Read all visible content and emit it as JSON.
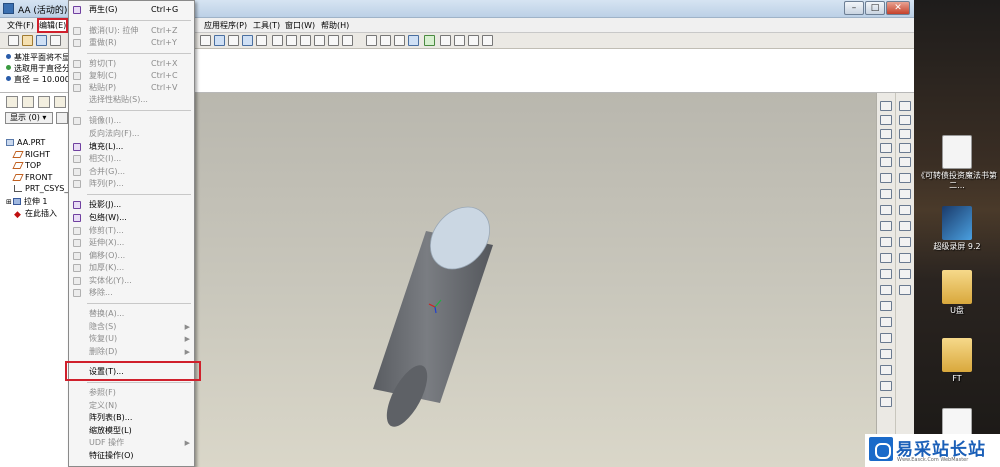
{
  "window": {
    "title": "AA (活动的) - P",
    "min_label": "–",
    "max_label": "□",
    "close_label": "✕"
  },
  "menubar": {
    "items": [
      {
        "label": "文件(F)"
      },
      {
        "label": "编辑(E)"
      },
      {
        "label": "应用程序(P)"
      },
      {
        "label": "工具(T)"
      },
      {
        "label": "窗口(W)"
      },
      {
        "label": "帮助(H)"
      }
    ]
  },
  "messages": [
    "基准平面将不显",
    "选取用于直径分",
    "直径 = 10.0000"
  ],
  "navigator": {
    "show_label": "显示 (0) ▾",
    "tree": [
      {
        "label": "AA.PRT",
        "icon": "part-icon"
      },
      {
        "label": "RIGHT",
        "icon": "datum-plane-icon"
      },
      {
        "label": "TOP",
        "icon": "datum-plane-icon"
      },
      {
        "label": "FRONT",
        "icon": "datum-plane-icon"
      },
      {
        "label": "PRT_CSYS_",
        "icon": "csys-icon"
      },
      {
        "label": "拉伸 1",
        "icon": "extrude-icon"
      },
      {
        "label": "在此插入",
        "icon": "insert-here-icon"
      }
    ]
  },
  "edit_menu": {
    "items": [
      {
        "label": "再生(G)",
        "shortcut": "Ctrl+G",
        "disabled": false,
        "icon": "regenerate-icon"
      },
      {
        "label": "撤消(U): 拉伸",
        "shortcut": "Ctrl+Z",
        "disabled": true
      },
      {
        "label": "重做(R)",
        "shortcut": "Ctrl+Y",
        "disabled": true
      },
      {
        "label": "剪切(T)",
        "shortcut": "Ctrl+X",
        "disabled": true
      },
      {
        "label": "复制(C)",
        "shortcut": "Ctrl+C",
        "disabled": true
      },
      {
        "label": "粘贴(P)",
        "shortcut": "Ctrl+V",
        "disabled": true
      },
      {
        "label": "选择性粘贴(S)...",
        "shortcut": "",
        "disabled": true
      },
      {
        "label": "镜像(I)...",
        "shortcut": "",
        "disabled": true
      },
      {
        "label": "反向法向(F)...",
        "shortcut": "",
        "disabled": true
      },
      {
        "label": "填充(L)...",
        "shortcut": "",
        "disabled": false
      },
      {
        "label": "相交(I)...",
        "shortcut": "",
        "disabled": true
      },
      {
        "label": "合并(G)...",
        "shortcut": "",
        "disabled": true
      },
      {
        "label": "阵列(P)...",
        "shortcut": "",
        "disabled": true
      },
      {
        "label": "投影(J)...",
        "shortcut": "",
        "disabled": false
      },
      {
        "label": "包络(W)...",
        "shortcut": "",
        "disabled": false
      },
      {
        "label": "修剪(T)...",
        "shortcut": "",
        "disabled": true
      },
      {
        "label": "延伸(X)...",
        "shortcut": "",
        "disabled": true
      },
      {
        "label": "偏移(O)...",
        "shortcut": "",
        "disabled": true
      },
      {
        "label": "加厚(K)...",
        "shortcut": "",
        "disabled": true
      },
      {
        "label": "实体化(Y)...",
        "shortcut": "",
        "disabled": true
      },
      {
        "label": "移除...",
        "shortcut": "",
        "disabled": true
      },
      {
        "label": "替换(A)...",
        "shortcut": "",
        "disabled": true
      },
      {
        "label": "隐含(S)",
        "shortcut": "",
        "disabled": true,
        "submenu": true
      },
      {
        "label": "恢复(U)",
        "shortcut": "",
        "disabled": true,
        "submenu": true
      },
      {
        "label": "删除(D)",
        "shortcut": "",
        "disabled": true,
        "submenu": true
      },
      {
        "label": "设置(T)...",
        "shortcut": "",
        "disabled": false
      },
      {
        "label": "参照(F)",
        "shortcut": "",
        "disabled": true
      },
      {
        "label": "定义(N)",
        "shortcut": "",
        "disabled": true
      },
      {
        "label": "阵列表(B)...",
        "shortcut": "",
        "disabled": false
      },
      {
        "label": "缩放模型(L)",
        "shortcut": "",
        "disabled": false
      },
      {
        "label": "UDF 操作",
        "shortcut": "",
        "disabled": true,
        "submenu": true
      },
      {
        "label": "特征操作(O)",
        "shortcut": "",
        "disabled": false
      }
    ]
  },
  "desktop": {
    "icons": [
      {
        "label": "《可转债投资魔法书第二..."
      },
      {
        "label": "超级录屏 9.2"
      },
      {
        "label": "U盘"
      },
      {
        "label": "FT"
      }
    ]
  },
  "watermark": {
    "title": "易采站长站",
    "subtitle": "Www.Easck.Com WebMaster"
  },
  "colors": {
    "highlight_box": "#d0202c",
    "cylinder_body": "#6e7176",
    "cylinder_top": "#c9d6e2",
    "viewport_bg": "#c8c6bb"
  }
}
